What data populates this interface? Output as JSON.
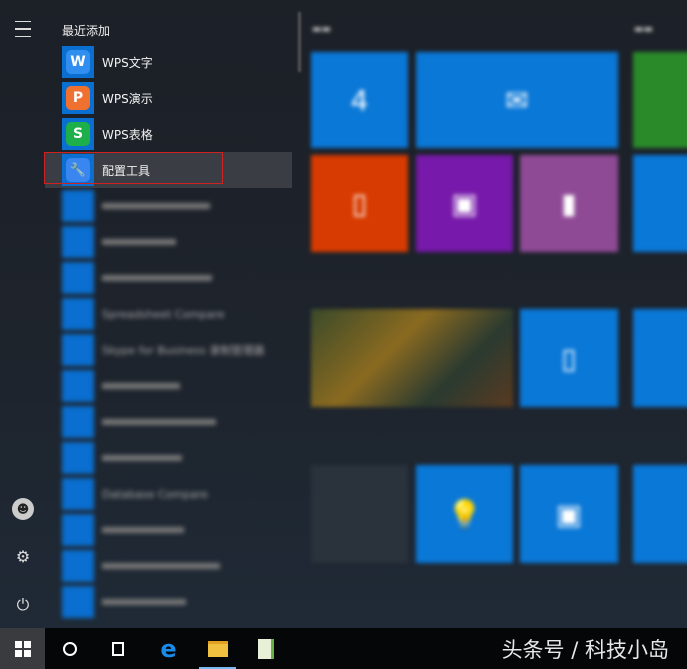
{
  "start_menu": {
    "section_title": "最近添加",
    "apps": [
      {
        "label": "WPS文字",
        "glyph": "W",
        "color": "#2f8ef0"
      },
      {
        "label": "WPS演示",
        "glyph": "P",
        "color": "#f07030"
      },
      {
        "label": "WPS表格",
        "glyph": "S",
        "color": "#1db04a"
      },
      {
        "label": "配置工具",
        "glyph": "🔧",
        "color": "#3a86f0",
        "selected": true
      }
    ],
    "blurred_apps": [
      "Spreadsheet Compare",
      "Skype for Business 录制管理器",
      "Database Compare"
    ]
  },
  "tiles": {
    "calendar_day": "4"
  },
  "watermark": "头条号 / 科技小岛",
  "colors": {
    "accent": "#0a78d7",
    "office": "#d83b01",
    "onenote": "#7719aa",
    "onenote2016": "#8f4a96",
    "highlight_box": "#d02020"
  }
}
